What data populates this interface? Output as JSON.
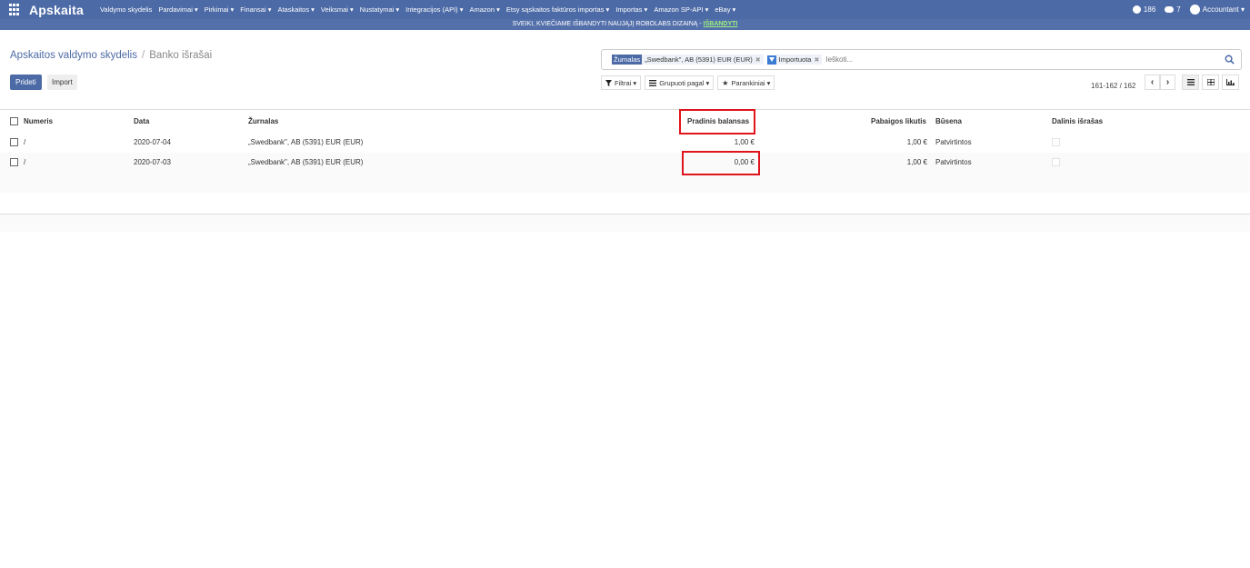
{
  "app": {
    "brand": "Apskaita"
  },
  "nav": {
    "items": [
      "Valdymo skydelis",
      "Pardavimai ▾",
      "Pirkimai ▾",
      "Finansai ▾",
      "Ataskaitos ▾",
      "Veiksmai ▾",
      "Nustatymai ▾",
      "Integracijos (API) ▾",
      "Amazon ▾",
      "Etsy sąskaitos faktūros importas ▾",
      "Importas ▾",
      "Amazon SP-API ▾",
      "eBay ▾"
    ],
    "notifications_count": "186",
    "messages_count": "7",
    "user": "Accountant ▾"
  },
  "banner": {
    "text": "SVEIKI, KVIEČIAME IŠBANDYTI NAUJĄJĮ ROBOLABS DIZAINĄ - ",
    "link": "IŠBANDYTI"
  },
  "breadcrumb": {
    "parent": "Apskaitos valdymo skydelis",
    "current": "Banko išrašai"
  },
  "buttons": {
    "create": "Prideti",
    "import": "Import"
  },
  "search": {
    "facets": [
      {
        "label": "Žurnalas",
        "value": "„Swedbank\", AB (5391) EUR (EUR)"
      },
      {
        "label": "",
        "value": "Importuota"
      }
    ],
    "placeholder": "Ieškoti..."
  },
  "filters": {
    "filters": "Filtrai ▾",
    "group_by": "Grupuoti pagal ▾",
    "favorites": "Parankiniai ▾"
  },
  "pager": {
    "text": "161-162 / 162"
  },
  "table": {
    "headers": {
      "number": "Numeris",
      "date": "Data",
      "journal": "Žurnalas",
      "start_balance": "Pradinis balansas",
      "end_balance": "Pabaigos likutis",
      "status": "Būsena",
      "partial": "Dalinis išrašas"
    },
    "rows": [
      {
        "number": "/",
        "date": "2020-07-04",
        "journal": "„Swedbank\", AB (5391) EUR (EUR)",
        "start_balance": "1,00 €",
        "end_balance": "1,00 €",
        "status": "Patvirtintos"
      },
      {
        "number": "/",
        "date": "2020-07-03",
        "journal": "„Swedbank\", AB (5391) EUR (EUR)",
        "start_balance": "0,00 €",
        "end_balance": "1,00 €",
        "status": "Patvirtintos"
      }
    ]
  },
  "colors": {
    "navbar": "#4c6aa6",
    "highlight": "#e0141c",
    "banner_link": "#9ef07d"
  }
}
